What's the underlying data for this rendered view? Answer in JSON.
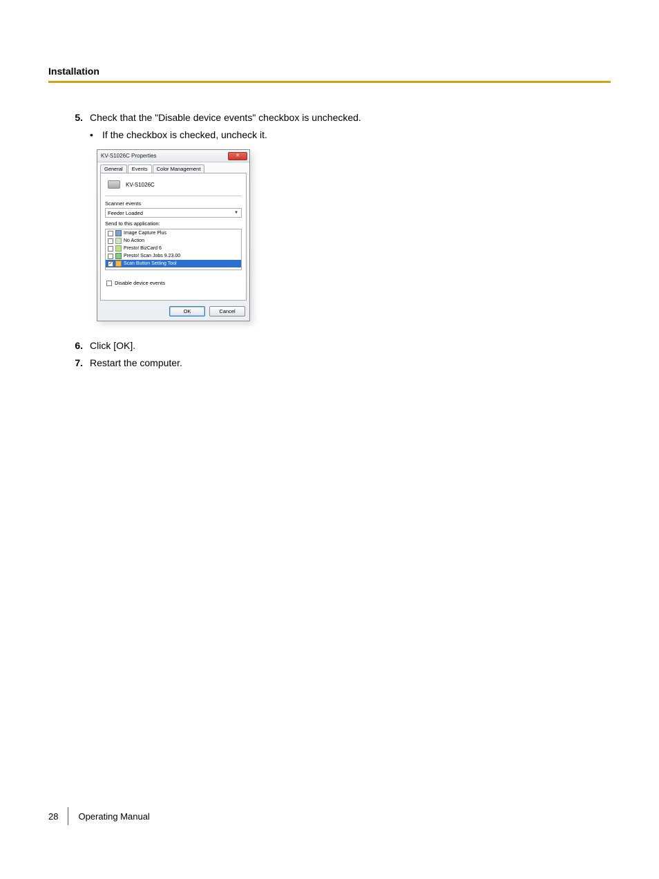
{
  "header": {
    "section": "Installation"
  },
  "steps": {
    "s5": {
      "num": "5.",
      "text": "Check that the \"Disable device events\" checkbox is unchecked."
    },
    "s5_bullet": "If the checkbox is checked, uncheck it.",
    "s6": {
      "num": "6.",
      "text": "Click [OK]."
    },
    "s7": {
      "num": "7.",
      "text": "Restart the computer."
    }
  },
  "dialog": {
    "title": "KV-S1026C Properties",
    "close_glyph": "✕",
    "tabs": {
      "general": "General",
      "events": "Events",
      "color": "Color Management"
    },
    "device_name": "KV-S1026C",
    "scanner_events_label": "Scanner events",
    "select_value": "Feeder Loaded",
    "send_label": "Send to this application:",
    "apps": [
      {
        "label": "Image Capture Plus"
      },
      {
        "label": "No Action"
      },
      {
        "label": "Presto! BizCard 6"
      },
      {
        "label": "Presto! Scan Jobs 9.23.00"
      },
      {
        "label": "Scan Button Setting Tool"
      }
    ],
    "disable_label": "Disable device events",
    "ok_label": "OK",
    "cancel_label": "Cancel"
  },
  "footer": {
    "page": "28",
    "title": "Operating Manual"
  }
}
